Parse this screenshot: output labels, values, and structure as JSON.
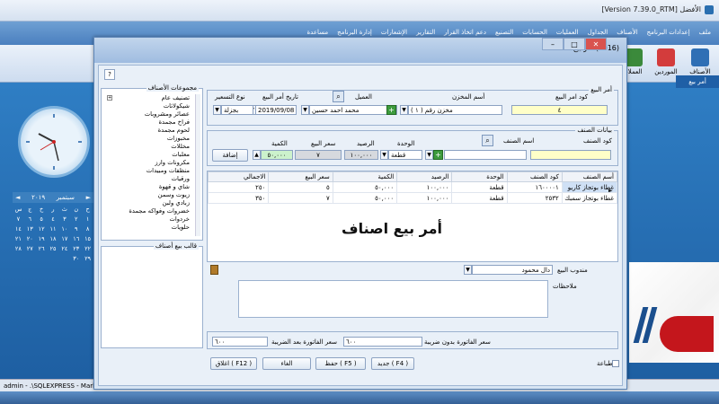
{
  "app": {
    "title": "[Version 7.39.0_RTM] الأفضل",
    "menu": [
      "ملف",
      "إعدادات البرنامج",
      "الأصناف",
      "الجداول",
      "العمليات",
      "الحسابات",
      "التصنيع",
      "دعم اتخاذ القرار",
      "التقارير",
      "الإشعارات",
      "إدارة البرنامج",
      "مساعدة"
    ],
    "ribbon": [
      {
        "label": "الأصناف",
        "icon": "items-icon",
        "color": "#2f6fb5"
      },
      {
        "label": "الموردين",
        "icon": "suppliers-icon",
        "color": "#d33c3c"
      },
      {
        "label": "العملاء",
        "icon": "customers-icon",
        "color": "#3b8a3b"
      }
    ],
    "doc_tab": "أمر بيع",
    "status": "admin  -  .\\SQLEXPRESS  -  Marke"
  },
  "desktop": {
    "calendar": {
      "month": "سبتمبر",
      "year": "٢٠١٩",
      "days_header": [
        "س",
        "ج",
        "خ",
        "ر",
        "ث",
        "ن",
        "ح"
      ],
      "rows": [
        [
          "٧",
          "٦",
          "٥",
          "٤",
          "٣",
          "٢",
          "١"
        ],
        [
          "١٤",
          "١٣",
          "١٢",
          "١١",
          "١٠",
          "٩",
          "٨"
        ],
        [
          "٢١",
          "٢٠",
          "١٩",
          "١٨",
          "١٧",
          "١٦",
          "١٥"
        ],
        [
          "٢٨",
          "٢٧",
          "٢٦",
          "٢٥",
          "٢٤",
          "٢٣",
          "٢٢"
        ],
        [
          "",
          "",
          "",
          "",
          "",
          "٣٠",
          "٢٩"
        ]
      ]
    }
  },
  "dialog": {
    "title": "أمر بيع  (F016)",
    "help": "?",
    "groups_title": "مجموعات الأصناف",
    "groups": [
      "تصنيف عام",
      "شيكولاتات",
      "عصائر ومشروبات",
      "فراخ مجمدة",
      "لحوم مجمدة",
      "مخبوزات",
      "مخللات",
      "معلبات",
      "مكرونات وارز",
      "منظفات ومبيدات",
      "ورقيات",
      "شاي و قهوة",
      "زيوت وسمن",
      "زبادي ولبن",
      "خضروات وفواكه مجمدة",
      "خردوات",
      "حلويات"
    ],
    "template_title": "قالب بيع أصناف",
    "order_section": "أمر البيع",
    "order_no_label": "كود امر البيع",
    "order_no": "٤",
    "warehouse_label": "أسم المخزن",
    "warehouse": "مخزن رقم ( ١ )",
    "customer_label": "العميل",
    "customer": "محمد احمد حسين",
    "date_label": "تاريخ أمر البيع",
    "date": "2019/09/08",
    "price_type_label": "نوع التسعير",
    "price_type": "بجزلة",
    "item_section": "بيانات الصنف",
    "item_code_label": "كود الصنف",
    "item_name_label": "اسم الصنف",
    "unit_label": "الوحدة",
    "unit": "قطعة",
    "balance_label": "الرصيد",
    "balance": "١٠٠,٠٠٠",
    "price_label": "سعر البيع",
    "price": "٧",
    "qty_label": "الكمية",
    "qty": "٥٠,٠٠٠",
    "add_button": "إضافة",
    "grid_headers": [
      "أسم الصنف",
      "كود الصنف",
      "الوحدة",
      "الرصيد",
      "الكمية",
      "سعر البيع",
      "الاجمالي"
    ],
    "grid_rows": [
      [
        "غطاء بوتجاز كاريو",
        "١٦٠٠٠٠١",
        "قطعة",
        "١٠٠,٠٠٠",
        "٥٠,٠٠٠",
        "٥",
        "٢٥٠"
      ],
      [
        "غطاء بوتجاز سمبك",
        "٢٥٣٢",
        "قطعة",
        "١٠٠,٠٠٠",
        "٥٠,٠٠٠",
        "٧",
        "٣٥٠"
      ]
    ],
    "watermark": "أمر بيع اصناف",
    "rep_label": "مندوب البيع",
    "rep": "دال محمود",
    "notes_label": "ملاحظات",
    "total_pre_label": "سعر الفاتورة  بدون ضريبة",
    "total_pre": "٦٠٠",
    "total_post_label": "سعر الفاتورة  بعد الضريبة",
    "total_post": "٦٠٠",
    "print_label": "طباعة",
    "btn_new": "جديد  ( F4 )",
    "btn_save": "حفظ  ( F5 )",
    "btn_cancel": "الغاء",
    "btn_close": "اغلاق  ( F12 )"
  }
}
